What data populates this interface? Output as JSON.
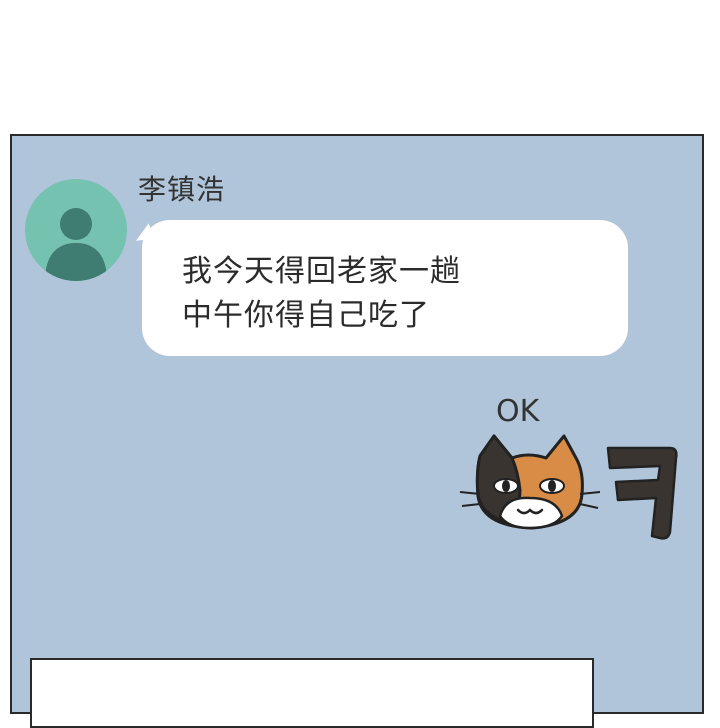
{
  "incoming_message": {
    "sender_name": "李镇浩",
    "lines": [
      "我今天得回老家一趟",
      "中午你得自己吃了"
    ],
    "avatar_icon": "person-silhouette-icon"
  },
  "reply": {
    "text": "OK",
    "sticker_icon": "calico-cat-laughing-sticker",
    "sticker_glyph": "ㅋ"
  },
  "colors": {
    "chat_background": "#b1c5da",
    "avatar_background": "#76c2b0",
    "avatar_figure": "#3f7c71",
    "bubble": "#ffffff",
    "cat_orange": "#d98c45",
    "cat_dark": "#3a3430"
  }
}
